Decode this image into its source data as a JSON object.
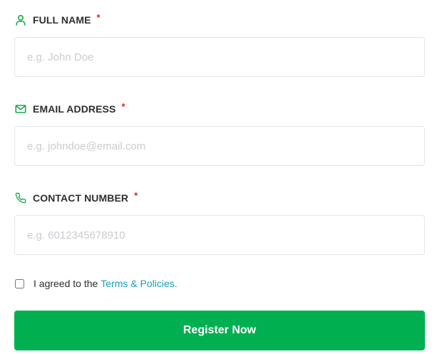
{
  "form": {
    "fields": [
      {
        "icon": "user-icon",
        "label": "FULL NAME",
        "required_mark": "*",
        "placeholder": "e.g. John Doe",
        "value": ""
      },
      {
        "icon": "envelope-icon",
        "label": "EMAIL ADDRESS",
        "required_mark": "*",
        "placeholder": "e.g. johndoe@email.com",
        "value": ""
      },
      {
        "icon": "phone-icon",
        "label": "CONTACT NUMBER",
        "required_mark": "*",
        "placeholder": "e.g. 6012345678910",
        "value": ""
      }
    ],
    "agreement": {
      "checked": false,
      "text": "I agreed to the",
      "link_text": "Terms & Policies."
    },
    "submit_label": "Register Now"
  },
  "colors": {
    "accent_green": "#00b050",
    "icon_green": "#1fa64a",
    "required_red": "#e02424",
    "link_teal": "#1a9fb5",
    "placeholder_gray": "#c9ccd1",
    "border_gray": "#e3e5e8"
  }
}
